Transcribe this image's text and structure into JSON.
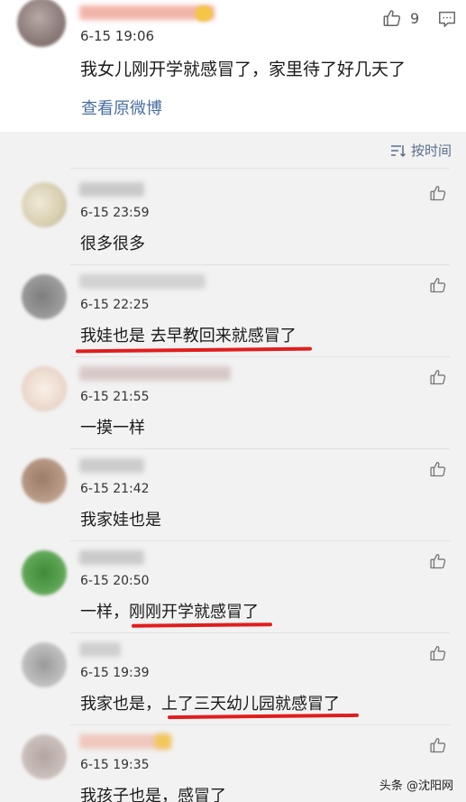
{
  "post": {
    "time": "6-15 19:06",
    "text": "我女儿刚开学就感冒了，家里待了好几天了",
    "view_original": "查看原微博",
    "like_count": "9"
  },
  "sort": {
    "label": "按时间"
  },
  "comments": [
    {
      "time": "6-15 23:59",
      "text": "很多很多"
    },
    {
      "time": "6-15 22:25",
      "text": "我娃也是 去早教回来就感冒了"
    },
    {
      "time": "6-15 21:55",
      "text": "一摸一样"
    },
    {
      "time": "6-15 21:42",
      "text": "我家娃也是"
    },
    {
      "time": "6-15 20:50",
      "text": "一样，刚刚开学就感冒了"
    },
    {
      "time": "6-15 19:39",
      "text": "我家也是，上了三天幼儿园就感冒了"
    },
    {
      "time": "6-15 19:35",
      "text": "我孩子也是，感冒了"
    }
  ],
  "watermark": {
    "text": "头条 @沈阳网"
  },
  "colors": {
    "link": "#4a6fa0",
    "underline": "#e11d1d",
    "background": "#f2f2f2"
  },
  "icons": {
    "like": "thumbs-up-icon",
    "comment": "comment-icon",
    "sort": "sort-icon"
  }
}
